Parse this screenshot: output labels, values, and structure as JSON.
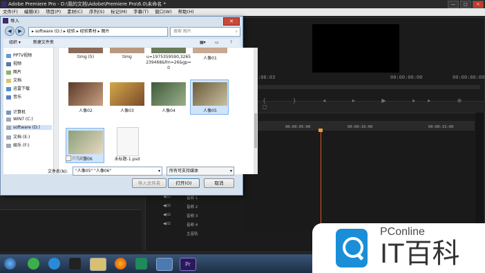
{
  "premiere": {
    "title": "Adobe Premiere Pro - D:\\我的文档\\Adobe\\Premiere Pro\\6.0\\未命名 *",
    "menu": [
      "文件(F)",
      "编辑(E)",
      "项目(P)",
      "素材(C)",
      "序列(S)",
      "标记(M)",
      "字幕(T)",
      "窗口(W)",
      "帮助(H)"
    ],
    "timecodes": {
      "source": "00:00:08:03",
      "program_left": "00:00:00:00",
      "program_right": "00:00:00:00"
    },
    "ruler": [
      "00:00:05:00",
      "00:00:10:00",
      "00:00:15:00"
    ],
    "audio_tracks": [
      "音频 1",
      "音频 2",
      "音频 3",
      "音频 4",
      "主音轨"
    ],
    "window_buttons": {
      "min": "—",
      "max": "□",
      "close": "✕"
    }
  },
  "dialog": {
    "title": "导入",
    "close_label": "✕",
    "address": [
      "software (D:)",
      "经验",
      "经验素材",
      "图片"
    ],
    "search_placeholder": "搜索 图片",
    "toolbar": {
      "organize": "组织 ▾",
      "new_folder": "新建文件夹"
    },
    "nav_items": [
      {
        "label": "PPTV视频",
        "icon": "video-folder-icon"
      },
      {
        "label": "视频",
        "icon": "video-icon"
      },
      {
        "label": "图片",
        "icon": "pictures-icon"
      },
      {
        "label": "文档",
        "icon": "documents-icon"
      },
      {
        "label": "迅雷下载",
        "icon": "download-icon"
      },
      {
        "label": "音乐",
        "icon": "music-icon"
      },
      {
        "label": "计算机",
        "icon": "computer-icon"
      },
      {
        "label": "WIN7 (C:)",
        "icon": "drive-icon"
      },
      {
        "label": "software (D:)",
        "icon": "drive-icon"
      },
      {
        "label": "文档 (E:)",
        "icon": "drive-icon"
      },
      {
        "label": "娱乐 (F:)",
        "icon": "drive-icon"
      }
    ],
    "files": [
      {
        "name": "timg (5)"
      },
      {
        "name": "timg"
      },
      {
        "name": "u=1975359590,3265239468&fm=26&gp=0"
      },
      {
        "name": "人像01"
      },
      {
        "name": "人像02"
      },
      {
        "name": "人像03"
      },
      {
        "name": "人像04"
      },
      {
        "name": "人像05"
      },
      {
        "name": "人像06"
      },
      {
        "name": "未标题-1.psd"
      }
    ],
    "image_sequence_label": "图像序列",
    "filename_label": "文件名(N):",
    "filename_value": "\"人像05\" \"人像06\"",
    "filetype_value": "所有可支持媒体",
    "buttons": {
      "import_folder": "导入文件夹",
      "open": "打开(O)",
      "cancel": "取消"
    }
  },
  "brand": {
    "name": "PConline",
    "tagline": "IT百科"
  },
  "colors": {
    "accent": "#1a8fd8",
    "playhead": "#e0562a",
    "selection": "#cfe3fb"
  }
}
